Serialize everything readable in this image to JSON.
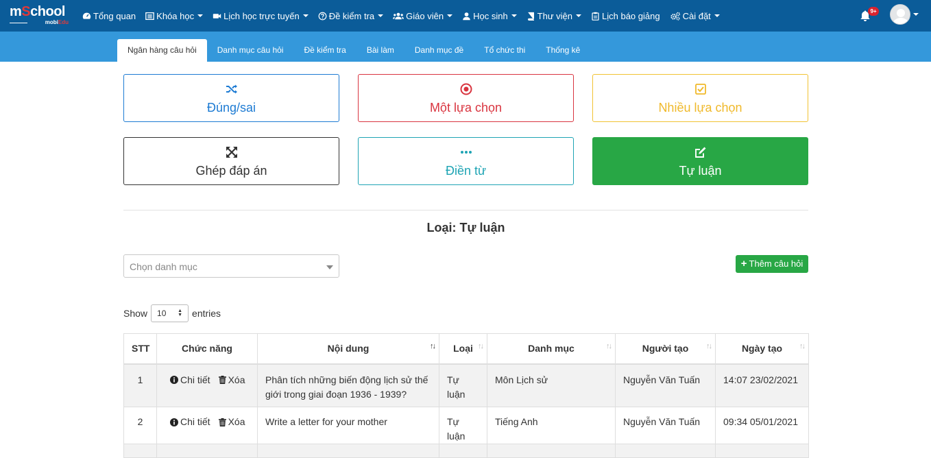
{
  "app": {
    "logo_main_a": "m",
    "logo_main_o": "S",
    "logo_main_b": "chool",
    "logo_sub_a": "mobi",
    "logo_sub_b": "Edu"
  },
  "nav": {
    "items": [
      {
        "label": "Tổng quan",
        "icon": "dashboard-icon"
      },
      {
        "label": "Khóa học",
        "icon": "list-icon"
      },
      {
        "label": "Lịch học trực tuyến",
        "icon": "video-icon"
      },
      {
        "label": "Đề kiểm tra",
        "icon": "question-circle-icon"
      },
      {
        "label": "Giáo viên",
        "icon": "users-icon"
      },
      {
        "label": "Học sinh",
        "icon": "user-icon"
      },
      {
        "label": "Thư viện",
        "icon": "book-icon"
      },
      {
        "label": "Lịch báo giảng",
        "icon": "clipboard-icon"
      },
      {
        "label": "Cài đặt",
        "icon": "cogs-icon"
      }
    ],
    "notification_badge": "9+"
  },
  "tabs": [
    "Ngân hàng câu hỏi",
    "Danh mục câu hỏi",
    "Đề kiểm tra",
    "Bài làm",
    "Danh mục đề",
    "Tổ chức thi",
    "Thống kê"
  ],
  "question_types": {
    "true_false": "Đúng/sai",
    "single_choice": "Một lựa chọn",
    "multiple_choice": "Nhiều lựa chọn",
    "matching": "Ghép đáp án",
    "fill_blank": "Điền từ",
    "essay": "Tự luận"
  },
  "type_heading": "Loại: Tự luận",
  "category_select": {
    "placeholder": "Chọn danh mục"
  },
  "add_button": "Thêm câu hỏi",
  "show_entries": {
    "prefix": "Show",
    "value": "10",
    "suffix": "entries"
  },
  "table": {
    "headers": [
      "STT",
      "Chức năng",
      "Nội dung",
      "Loại",
      "Danh mục",
      "Người tạo",
      "Ngày tạo"
    ],
    "action_detail": "Chi tiết",
    "action_delete": "Xóa",
    "rows": [
      {
        "stt": "1",
        "content": "Phân tích những biến động lịch sử thế giới trong giai đoạn 1936 - 1939?",
        "type": "Tự luận",
        "category": "Môn Lịch sử",
        "creator": "Nguyễn Văn Tuấn",
        "created": "14:07 23/02/2021"
      },
      {
        "stt": "2",
        "content": "Write a letter for your mother",
        "type": "Tự luận",
        "category": "Tiếng Anh",
        "creator": "Nguyễn Văn Tuấn",
        "created": "09:34 05/01/2021"
      }
    ]
  },
  "colors": {
    "navbar": "#0b5c99",
    "subbar": "#3498db",
    "success": "#28a745",
    "danger": "#d9343f",
    "primary": "#1d7bd3",
    "warning": "#f0b92b",
    "info": "#1ea4b4"
  }
}
